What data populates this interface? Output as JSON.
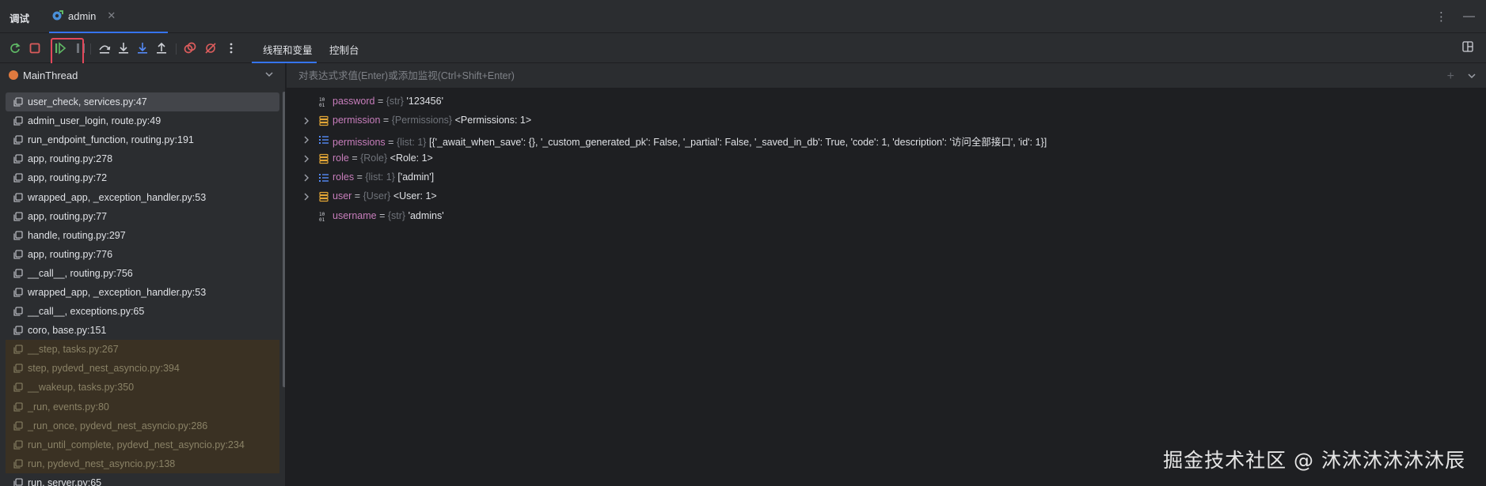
{
  "titlebar": {
    "panel_title": "调试",
    "session_tab": "admin",
    "close_glyph": "✕",
    "more_glyph": "⋮",
    "minimize_glyph": "—"
  },
  "toolbar": {
    "buttons": [
      "rerun-icon",
      "stop-icon",
      "resume-icon",
      "pause-icon",
      "step-over-icon",
      "step-into-icon",
      "step-into-my-code-icon",
      "step-out-icon",
      "view-breakpoints-icon",
      "mute-breakpoints-icon",
      "more-icon"
    ],
    "tabs": {
      "threads": "线程和变量",
      "console": "控制台"
    }
  },
  "threads": {
    "selected": "MainThread",
    "frames": [
      {
        "label": "user_check, services.py:47",
        "state": "selected"
      },
      {
        "label": "admin_user_login, route.py:49",
        "state": "normal"
      },
      {
        "label": "run_endpoint_function, routing.py:191",
        "state": "normal"
      },
      {
        "label": "app, routing.py:278",
        "state": "normal"
      },
      {
        "label": "app, routing.py:72",
        "state": "normal"
      },
      {
        "label": "wrapped_app, _exception_handler.py:53",
        "state": "normal"
      },
      {
        "label": "app, routing.py:77",
        "state": "normal"
      },
      {
        "label": "handle, routing.py:297",
        "state": "normal"
      },
      {
        "label": "app, routing.py:776",
        "state": "normal"
      },
      {
        "label": "__call__, routing.py:756",
        "state": "normal"
      },
      {
        "label": "wrapped_app, _exception_handler.py:53",
        "state": "normal"
      },
      {
        "label": "__call__, exceptions.py:65",
        "state": "normal"
      },
      {
        "label": "coro, base.py:151",
        "state": "normal"
      },
      {
        "label": "__step, tasks.py:267",
        "state": "lib"
      },
      {
        "label": "step, pydevd_nest_asyncio.py:394",
        "state": "lib"
      },
      {
        "label": "__wakeup, tasks.py:350",
        "state": "lib"
      },
      {
        "label": "_run, events.py:80",
        "state": "lib"
      },
      {
        "label": "_run_once, pydevd_nest_asyncio.py:286",
        "state": "lib"
      },
      {
        "label": "run_until_complete, pydevd_nest_asyncio.py:234",
        "state": "lib"
      },
      {
        "label": "run, pydevd_nest_asyncio.py:138",
        "state": "lib"
      },
      {
        "label": "run, server.py:65",
        "state": "normal"
      }
    ]
  },
  "watch": {
    "placeholder": "对表达式求值(Enter)或添加监视(Ctrl+Shift+Enter)",
    "add_glyph": "+"
  },
  "variables": [
    {
      "name": "password",
      "type": "{str}",
      "value": "'123456'",
      "icon": "primitive-icon",
      "expandable": false
    },
    {
      "name": "permission",
      "type": "{Permissions}",
      "value": "<Permissions: 1>",
      "icon": "object-icon",
      "expandable": true
    },
    {
      "name": "permissions",
      "type": "{list: 1}",
      "value": "[{'_await_when_save': {}, '_custom_generated_pk': False, '_partial': False, '_saved_in_db': True, 'code': 1, 'description': '访问全部接口', 'id': 1}]",
      "icon": "list-icon",
      "expandable": true
    },
    {
      "name": "role",
      "type": "{Role}",
      "value": "<Role: 1>",
      "icon": "object-icon",
      "expandable": true
    },
    {
      "name": "roles",
      "type": "{list: 1}",
      "value": "['admin']",
      "icon": "list-icon",
      "expandable": true
    },
    {
      "name": "user",
      "type": "{User}",
      "value": "<User: 1>",
      "icon": "object-icon",
      "expandable": true
    },
    {
      "name": "username",
      "type": "{str}",
      "value": "'admins'",
      "icon": "primitive-icon",
      "expandable": false
    }
  ],
  "colors": {
    "accent": "#3574f0",
    "highlight": "#e4485b",
    "thread_dot": "#e07a3f",
    "var_name": "#c77dbb"
  },
  "watermark": "掘金技术社区 @ 沐沐沐沐沐沐辰"
}
